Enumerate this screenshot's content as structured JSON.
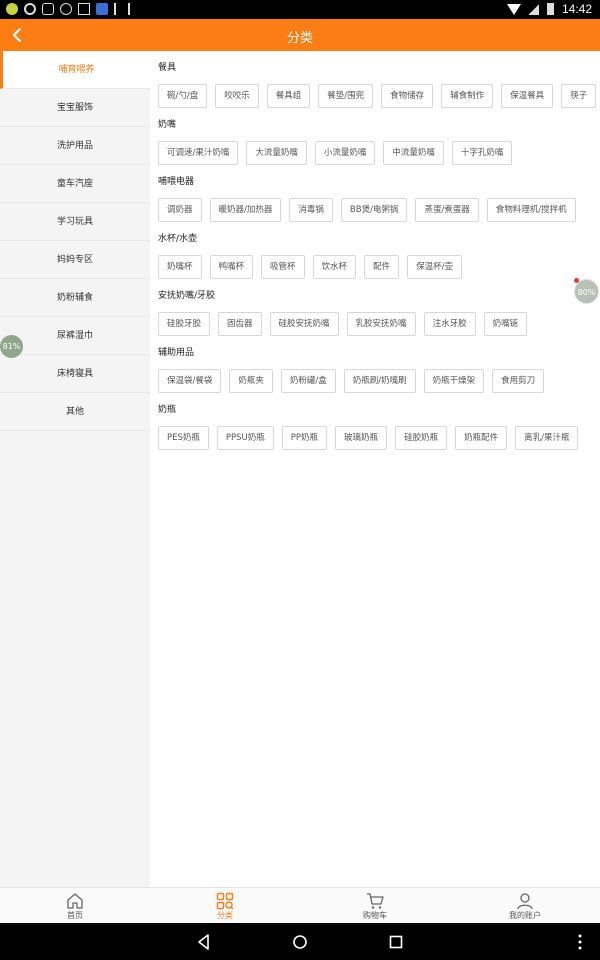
{
  "status_bar": {
    "time": "14:42"
  },
  "header": {
    "title": "分类",
    "back_icon": "chevron-left-icon"
  },
  "colors": {
    "accent": "#fb7d14"
  },
  "sidebar": {
    "items": [
      {
        "label": "哺育喂养",
        "active": true
      },
      {
        "label": "宝宝服饰"
      },
      {
        "label": "洗护用品"
      },
      {
        "label": "童车汽座"
      },
      {
        "label": "学习玩具"
      },
      {
        "label": "妈妈专区"
      },
      {
        "label": "奶粉辅食"
      },
      {
        "label": "尿裤湿巾"
      },
      {
        "label": "床椅寝具"
      },
      {
        "label": "其他"
      }
    ]
  },
  "sections": [
    {
      "title": "餐具",
      "items": [
        "碗/勺/盘",
        "咬咬乐",
        "餐具组",
        "餐垫/围兜",
        "食物储存",
        "辅食制作",
        "保温餐具",
        "筷子"
      ]
    },
    {
      "title": "奶嘴",
      "items": [
        "可调速/果汁奶嘴",
        "大流量奶嘴",
        "小流量奶嘴",
        "中流量奶嘴",
        "十字孔奶嘴"
      ]
    },
    {
      "title": "哺喂电器",
      "items": [
        "调奶器",
        "暖奶器/加热器",
        "消毒锅",
        "BB煲/电粥锅",
        "蒸蛋/煮蛋器",
        "食物料理机/搅拌机"
      ]
    },
    {
      "title": "水杯/水壶",
      "items": [
        "奶嘴杯",
        "鸭嘴杯",
        "吸管杯",
        "饮水杯",
        "配件",
        "保温杯/壶"
      ]
    },
    {
      "title": "安抚奶嘴/牙胶",
      "items": [
        "硅胶牙胶",
        "固齿器",
        "硅胶安抚奶嘴",
        "乳胶安抚奶嘴",
        "注水牙胶",
        "奶嘴链"
      ]
    },
    {
      "title": "辅助用品",
      "items": [
        "保温袋/餐袋",
        "奶瓶夹",
        "奶粉罐/盒",
        "奶瓶刷/奶嘴刷",
        "奶瓶干燥架",
        "食用剪刀"
      ]
    },
    {
      "title": "奶瓶",
      "items": [
        "PES奶瓶",
        "PPSU奶瓶",
        "PP奶瓶",
        "玻璃奶瓶",
        "硅胶奶瓶",
        "奶瓶配件",
        "离乳/果汁瓶"
      ]
    }
  ],
  "badges": {
    "left": "81%",
    "right": "80%"
  },
  "tabbar": {
    "tabs": [
      {
        "label": "首页",
        "icon": "home-icon"
      },
      {
        "label": "分类",
        "icon": "category-icon",
        "active": true
      },
      {
        "label": "购物车",
        "icon": "cart-icon"
      },
      {
        "label": "我的账户",
        "icon": "user-icon"
      }
    ]
  }
}
